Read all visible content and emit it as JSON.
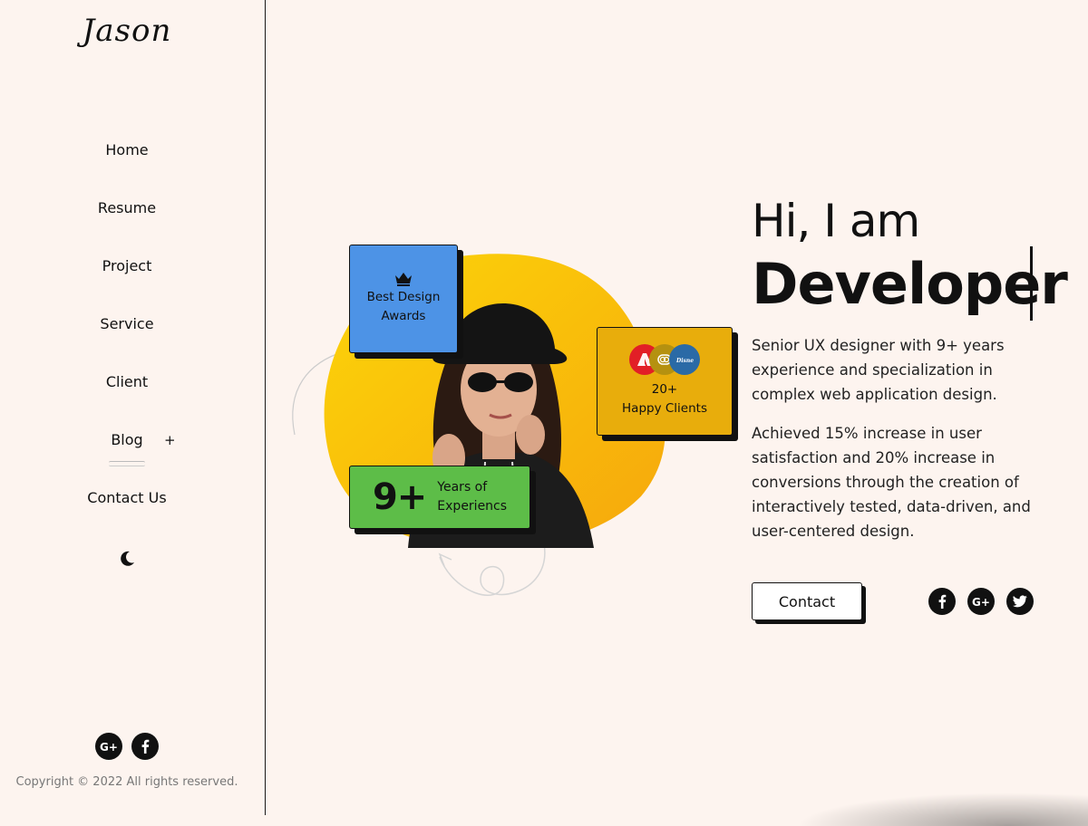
{
  "sidebar": {
    "logo": "Jason",
    "nav": [
      {
        "label": "Home"
      },
      {
        "label": "Resume"
      },
      {
        "label": "Project"
      },
      {
        "label": "Service"
      },
      {
        "label": "Client"
      },
      {
        "label": "Blog",
        "expand": "+"
      },
      {
        "label": "Contact Us"
      }
    ],
    "theme_toggle_icon": "moon-icon",
    "social_icons": [
      "google-plus-icon",
      "facebook-icon"
    ],
    "copyright": "Copyright © 2022 All rights reserved."
  },
  "hero": {
    "greeting": "Hi, I am",
    "role": "Developer",
    "paragraph1": "Senior UX designer with 9+ years experience and specialization in complex web application design.",
    "paragraph2": "Achieved 15% increase in user satisfaction and 20% increase in conversions through the creation of interactively tested, data-driven, and user-centered design.",
    "contact_label": "Contact",
    "social_icons": [
      "facebook-icon",
      "google-plus-icon",
      "twitter-icon"
    ]
  },
  "cards": {
    "award": {
      "icon": "crown-icon",
      "line1": "Best Design",
      "line2": "Awards",
      "color": "#4d93e6"
    },
    "clients": {
      "count": "20+",
      "label": "Happy Clients",
      "color": "#e8ad0c",
      "logos": [
        "adobe-logo",
        "client-logo",
        "disney-logo"
      ]
    },
    "years": {
      "value": "9+",
      "line1": "Years of",
      "line2": "Experiencs",
      "color": "#5dbd48"
    }
  },
  "colors": {
    "background": "#fdf4ef",
    "blob": "#fbc809",
    "text": "#111111"
  }
}
